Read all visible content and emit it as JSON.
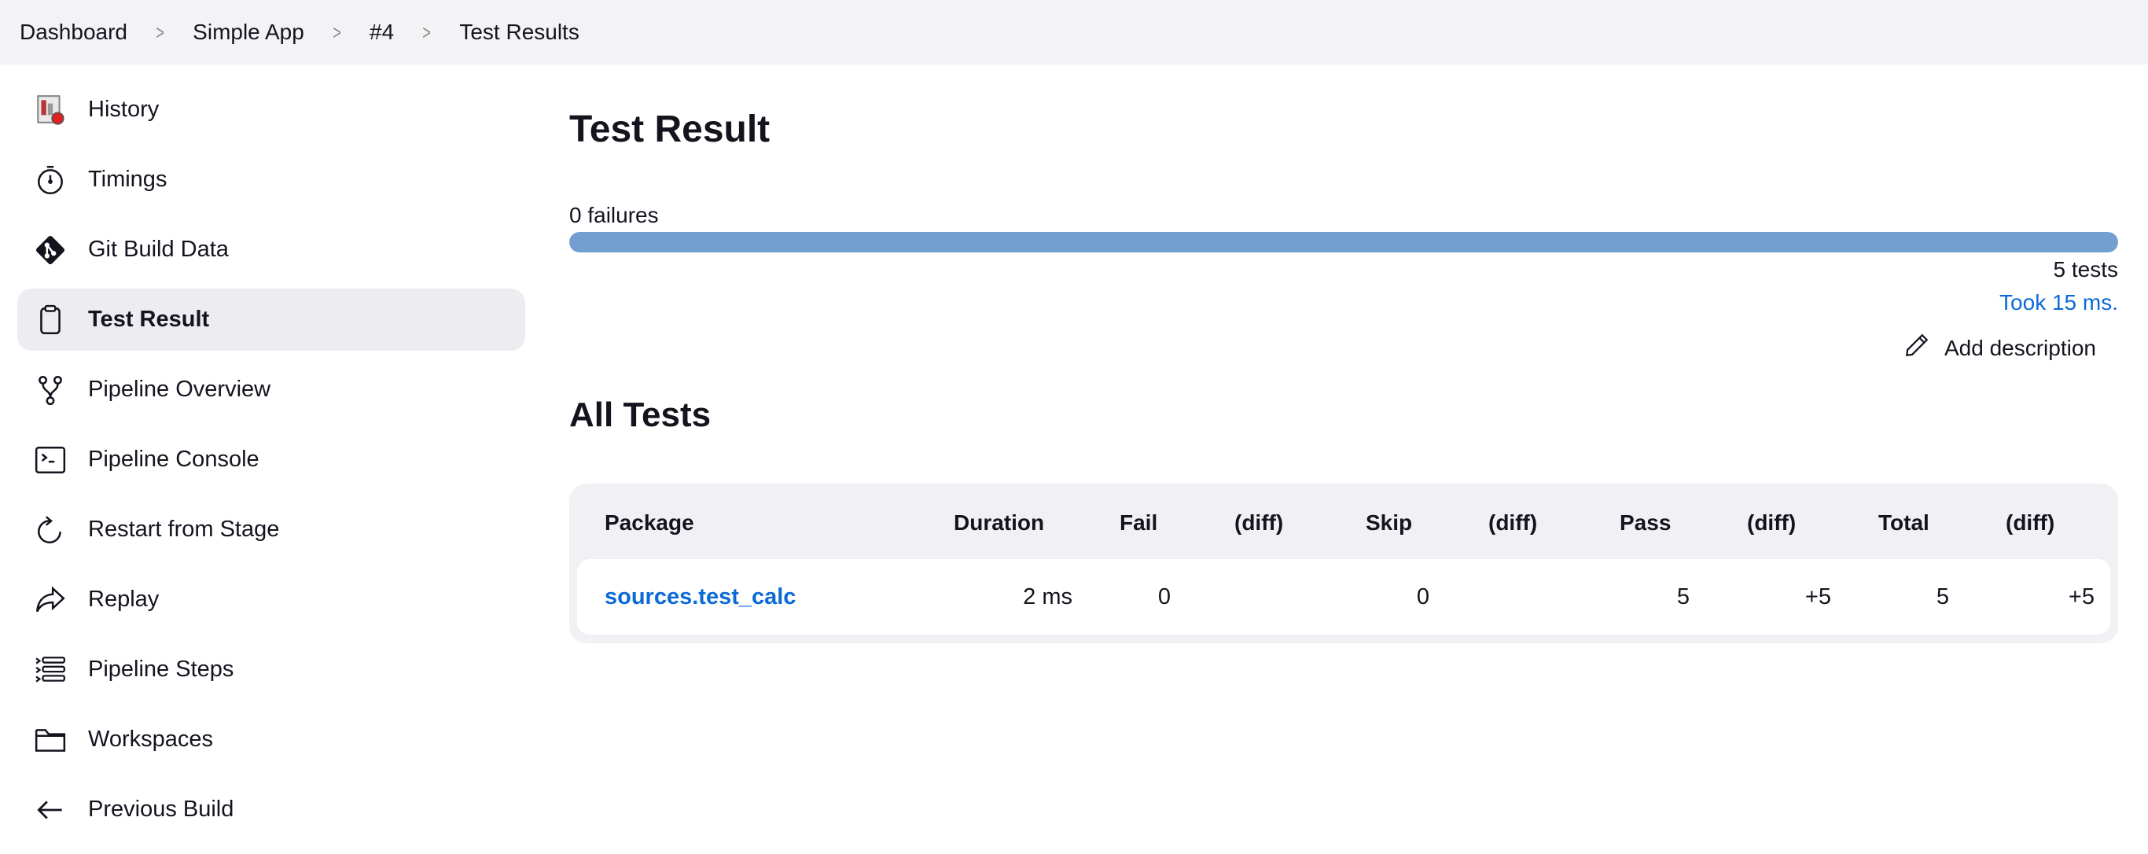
{
  "breadcrumb": [
    "Dashboard",
    "Simple App",
    "#4",
    "Test Results"
  ],
  "sidebar": {
    "items": [
      {
        "label": "History",
        "icon": "history-icon"
      },
      {
        "label": "Timings",
        "icon": "stopwatch-icon"
      },
      {
        "label": "Git Build Data",
        "icon": "git-icon"
      },
      {
        "label": "Test Result",
        "icon": "clipboard-icon",
        "active": true
      },
      {
        "label": "Pipeline Overview",
        "icon": "branch-icon"
      },
      {
        "label": "Pipeline Console",
        "icon": "terminal-icon"
      },
      {
        "label": "Restart from Stage",
        "icon": "restart-icon"
      },
      {
        "label": "Replay",
        "icon": "replay-icon"
      },
      {
        "label": "Pipeline Steps",
        "icon": "steps-list-icon"
      },
      {
        "label": "Workspaces",
        "icon": "folder-icon"
      },
      {
        "label": "Previous Build",
        "icon": "arrow-left-icon"
      }
    ]
  },
  "main": {
    "title": "Test Result",
    "failures_label": "0 failures",
    "pass_fraction": 1.0,
    "tests_label": "5 tests",
    "took_label": "Took 15 ms.",
    "add_description_label": "Add description",
    "all_tests_heading": "All Tests"
  },
  "table": {
    "headers": [
      "Package",
      "Duration",
      "Fail",
      "(diff)",
      "Skip",
      "(diff)",
      "Pass",
      "(diff)",
      "Total",
      "(diff)"
    ],
    "rows": [
      {
        "package": "sources.test_calc",
        "duration": "2 ms",
        "fail": "0",
        "fail_diff": "",
        "skip": "0",
        "skip_diff": "",
        "pass": "5",
        "pass_diff": "+5",
        "total": "5",
        "total_diff": "+5"
      }
    ]
  },
  "colors": {
    "accent": "#0b6ad6",
    "progress": "#729fcf",
    "topbar": "#f3f3f6",
    "active_item": "#ececf1"
  }
}
